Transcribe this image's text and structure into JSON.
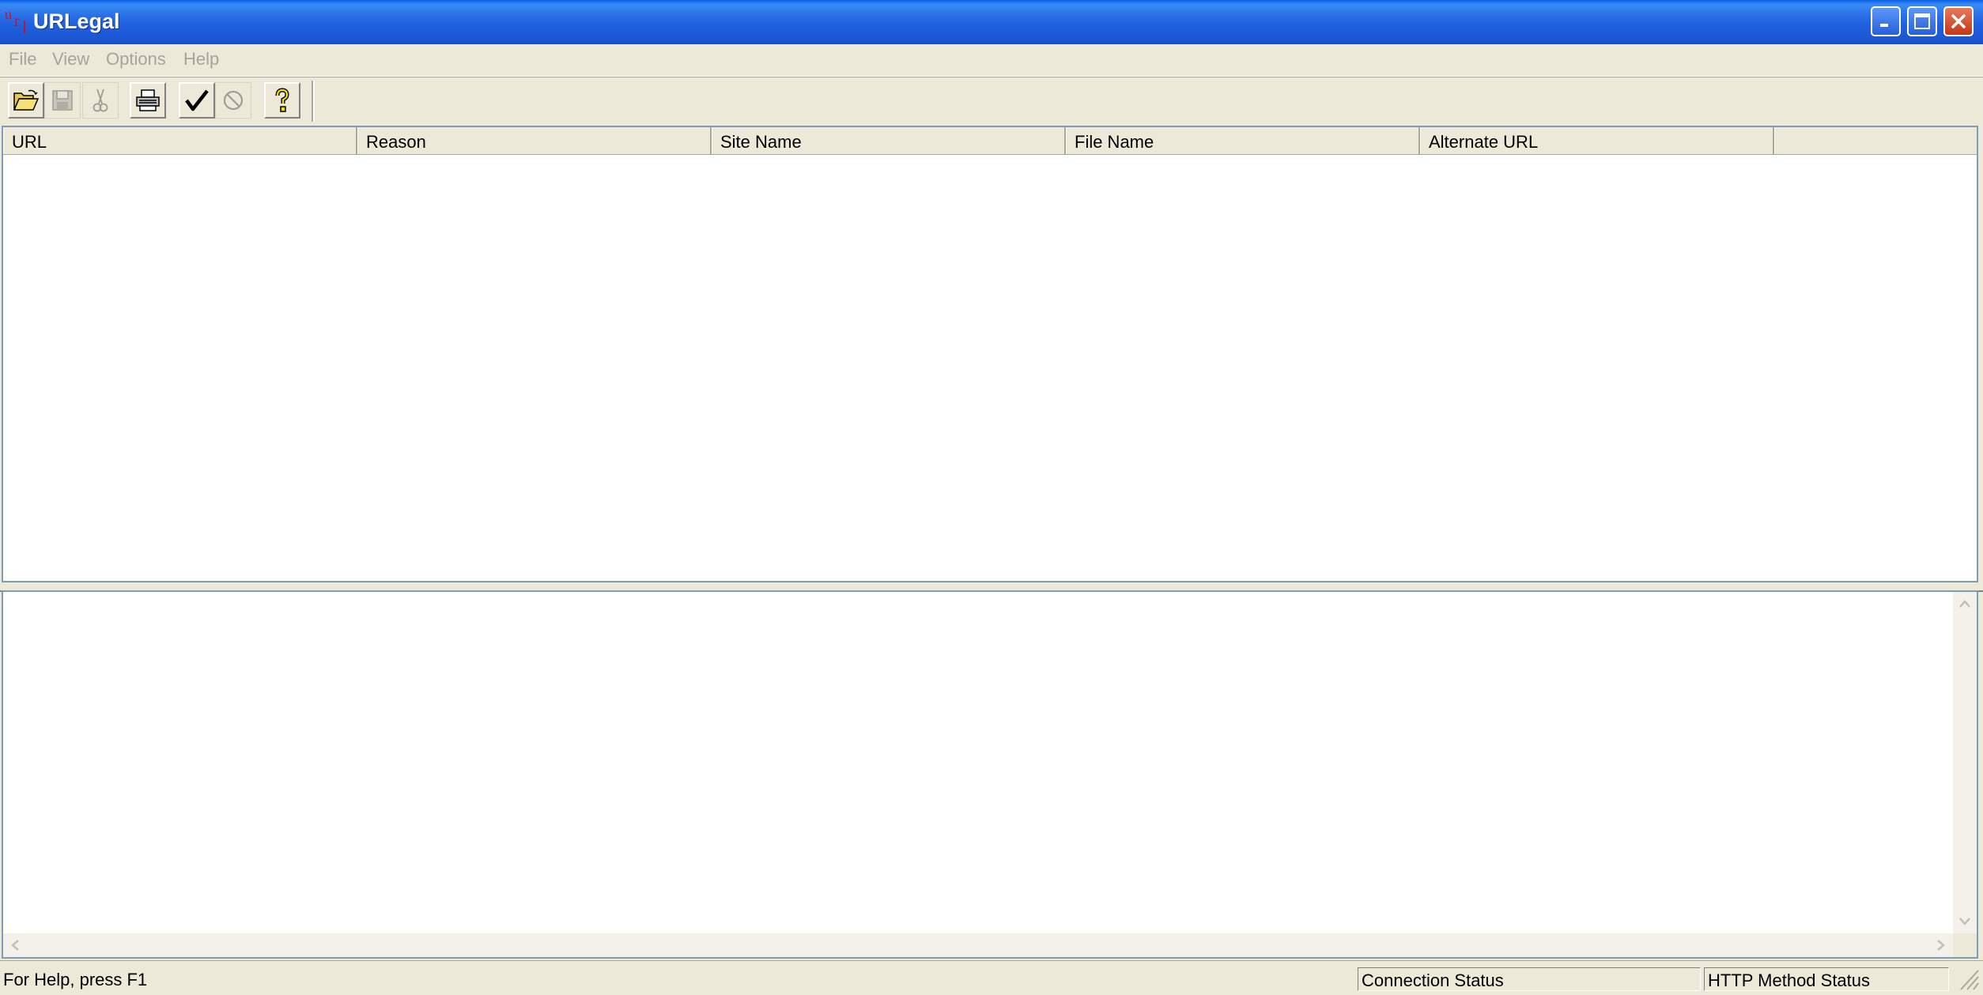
{
  "window": {
    "title": "URLegal",
    "icon_glyphs": [
      "u",
      "r",
      "l"
    ],
    "controls": {
      "minimize_icon": "minimize-icon",
      "maximize_icon": "maximize-icon",
      "close_icon": "close-icon"
    }
  },
  "menu": {
    "items": [
      {
        "label": "File"
      },
      {
        "label": "View"
      },
      {
        "label": "Options"
      },
      {
        "label": "Help"
      }
    ]
  },
  "toolbar": {
    "buttons": [
      {
        "icon": "folder-open-icon",
        "enabled": true
      },
      {
        "icon": "save-icon",
        "enabled": false
      },
      {
        "icon": "cut-icon",
        "enabled": false
      },
      {
        "icon": "print-icon",
        "enabled": true
      },
      {
        "icon": "check-icon",
        "enabled": true
      },
      {
        "icon": "stop-icon",
        "enabled": false
      },
      {
        "icon": "help-icon",
        "enabled": true
      }
    ]
  },
  "list": {
    "columns": [
      "URL",
      "Reason",
      "Site Name",
      "File Name",
      "Alternate URL"
    ],
    "rows": []
  },
  "log": {
    "lines": []
  },
  "statusbar": {
    "help_text": "For Help, press F1",
    "connection_status": "Connection Status",
    "http_method_status": "HTTP Method Status"
  },
  "colors": {
    "title_bar": "#2a6fe6",
    "close_button": "#d9532f",
    "menu_disabled_text": "#a7a59b",
    "chrome": "#ece9d8"
  }
}
